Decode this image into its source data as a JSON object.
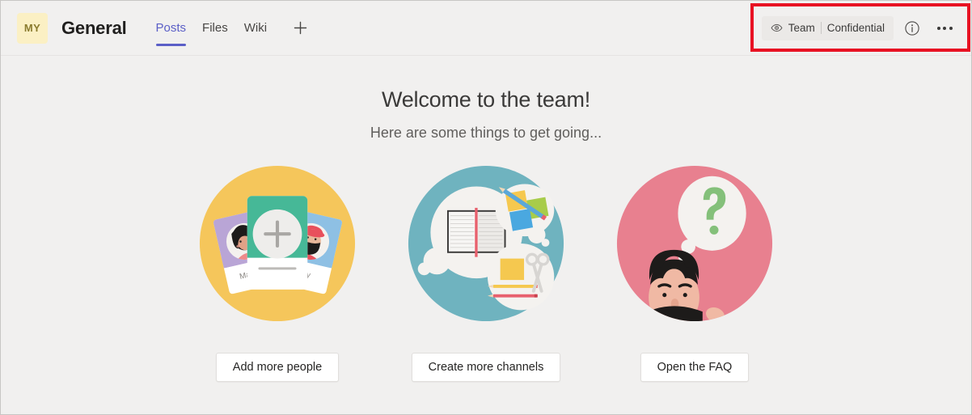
{
  "header": {
    "team_avatar_initials": "MY",
    "channel_title": "General",
    "tabs": [
      {
        "label": "Posts",
        "active": true
      },
      {
        "label": "Files",
        "active": false
      },
      {
        "label": "Wiki",
        "active": false
      }
    ],
    "add_tab_label": "+",
    "sensitivity": {
      "eye_icon": "eye-icon",
      "scope_label": "Team",
      "label": "Confidential"
    },
    "info_icon": "info-circle-icon",
    "more_icon": "more-options-icon"
  },
  "highlight": {
    "color": "#e81123"
  },
  "main": {
    "title": "Welcome to the team!",
    "subtitle": "Here are some things to get going...",
    "cards": [
      {
        "illustration": "people-cards-illustration",
        "circle_color": "#f5c65b",
        "button_label": "Add more people",
        "name_left": "Maxine",
        "name_right": "Ray"
      },
      {
        "illustration": "channels-thought-bubbles-illustration",
        "circle_color": "#6fb3bf",
        "button_label": "Create more channels"
      },
      {
        "illustration": "faq-question-illustration",
        "circle_color": "#e8808f",
        "button_label": "Open the FAQ"
      }
    ]
  },
  "colors": {
    "page_background": "#f1f0ef",
    "accent_purple": "#5b5fc7",
    "avatar_background": "#fbf0c4",
    "highlight_red": "#e81123"
  }
}
